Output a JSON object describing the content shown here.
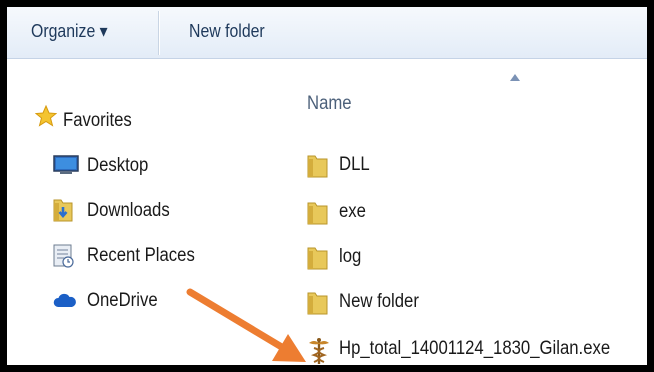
{
  "toolbar": {
    "organize_label": "Organize ▾",
    "new_folder_label": "New folder"
  },
  "nav": {
    "favorites": "Favorites",
    "desktop": "Desktop",
    "downloads": "Downloads",
    "recent_places": "Recent Places",
    "onedrive": "OneDrive"
  },
  "content": {
    "column_name": "Name",
    "files": [
      {
        "name": "DLL",
        "icon": "folder-icon"
      },
      {
        "name": "exe",
        "icon": "folder-icon"
      },
      {
        "name": "log",
        "icon": "folder-icon"
      },
      {
        "name": "New folder",
        "icon": "folder-icon"
      },
      {
        "name": "Hp_total_14001124_1830_Gilan.exe",
        "icon": "caduceus-exe-icon"
      }
    ]
  },
  "colors": {
    "annotation_arrow": "#ed7d31",
    "folder": "#e8c85a"
  }
}
